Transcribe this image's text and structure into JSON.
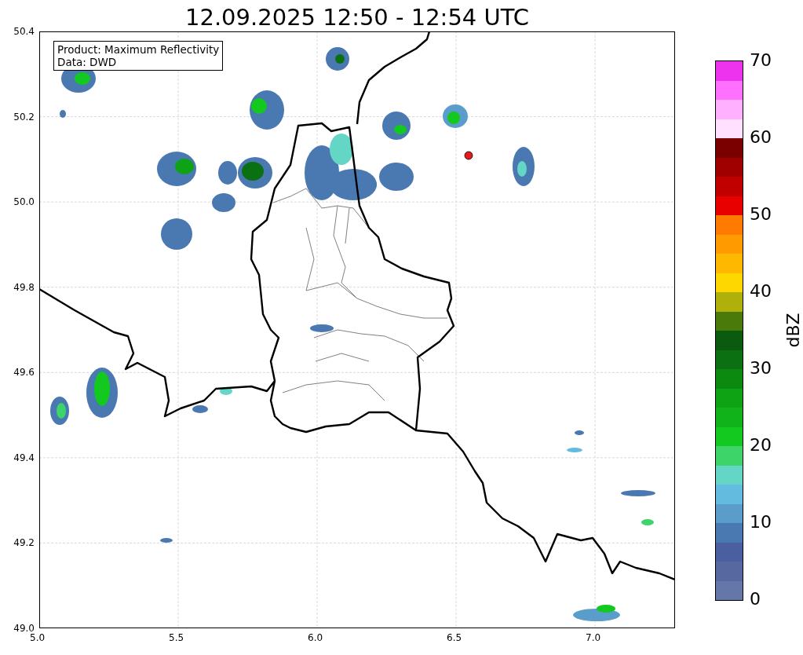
{
  "title": "12.09.2025 12:50 - 12:54 UTC",
  "info_box": {
    "lines": [
      "Product: Maximum Reflectivity",
      "Data: DWD"
    ]
  },
  "x_ticks": [
    "5.0",
    "5.5",
    "6.0",
    "6.5",
    "7.0"
  ],
  "y_ticks": [
    "50.4",
    "50.2",
    "50.0",
    "49.8",
    "49.6",
    "49.4",
    "49.2",
    "49.0"
  ],
  "colorbar": {
    "label": "dBZ",
    "ticks": [
      "70",
      "60",
      "50",
      "40",
      "30",
      "20",
      "10",
      "0"
    ],
    "bands": [
      {
        "color": "#6577a8"
      },
      {
        "color": "#56689f"
      },
      {
        "color": "#4a5fa0"
      },
      {
        "color": "#4a78b0"
      },
      {
        "color": "#5a9dcb"
      },
      {
        "color": "#63bce0"
      },
      {
        "color": "#63d6c6"
      },
      {
        "color": "#3dd46a"
      },
      {
        "color": "#13c81e"
      },
      {
        "color": "#10b41a"
      },
      {
        "color": "#0ea314"
      },
      {
        "color": "#0c8a10"
      },
      {
        "color": "#0b7012"
      },
      {
        "color": "#0a5a10"
      },
      {
        "color": "#4a7a0a"
      },
      {
        "color": "#b0b00a"
      },
      {
        "color": "#ffd700"
      },
      {
        "color": "#ffb800"
      },
      {
        "color": "#ff9a00"
      },
      {
        "color": "#ff7a00"
      },
      {
        "color": "#e80000"
      },
      {
        "color": "#c00000"
      },
      {
        "color": "#a00000"
      },
      {
        "color": "#7a0000"
      },
      {
        "color": "#ffe0ff"
      },
      {
        "color": "#ffb0ff"
      },
      {
        "color": "#ff70ff"
      },
      {
        "color": "#ee33ee"
      }
    ]
  }
}
